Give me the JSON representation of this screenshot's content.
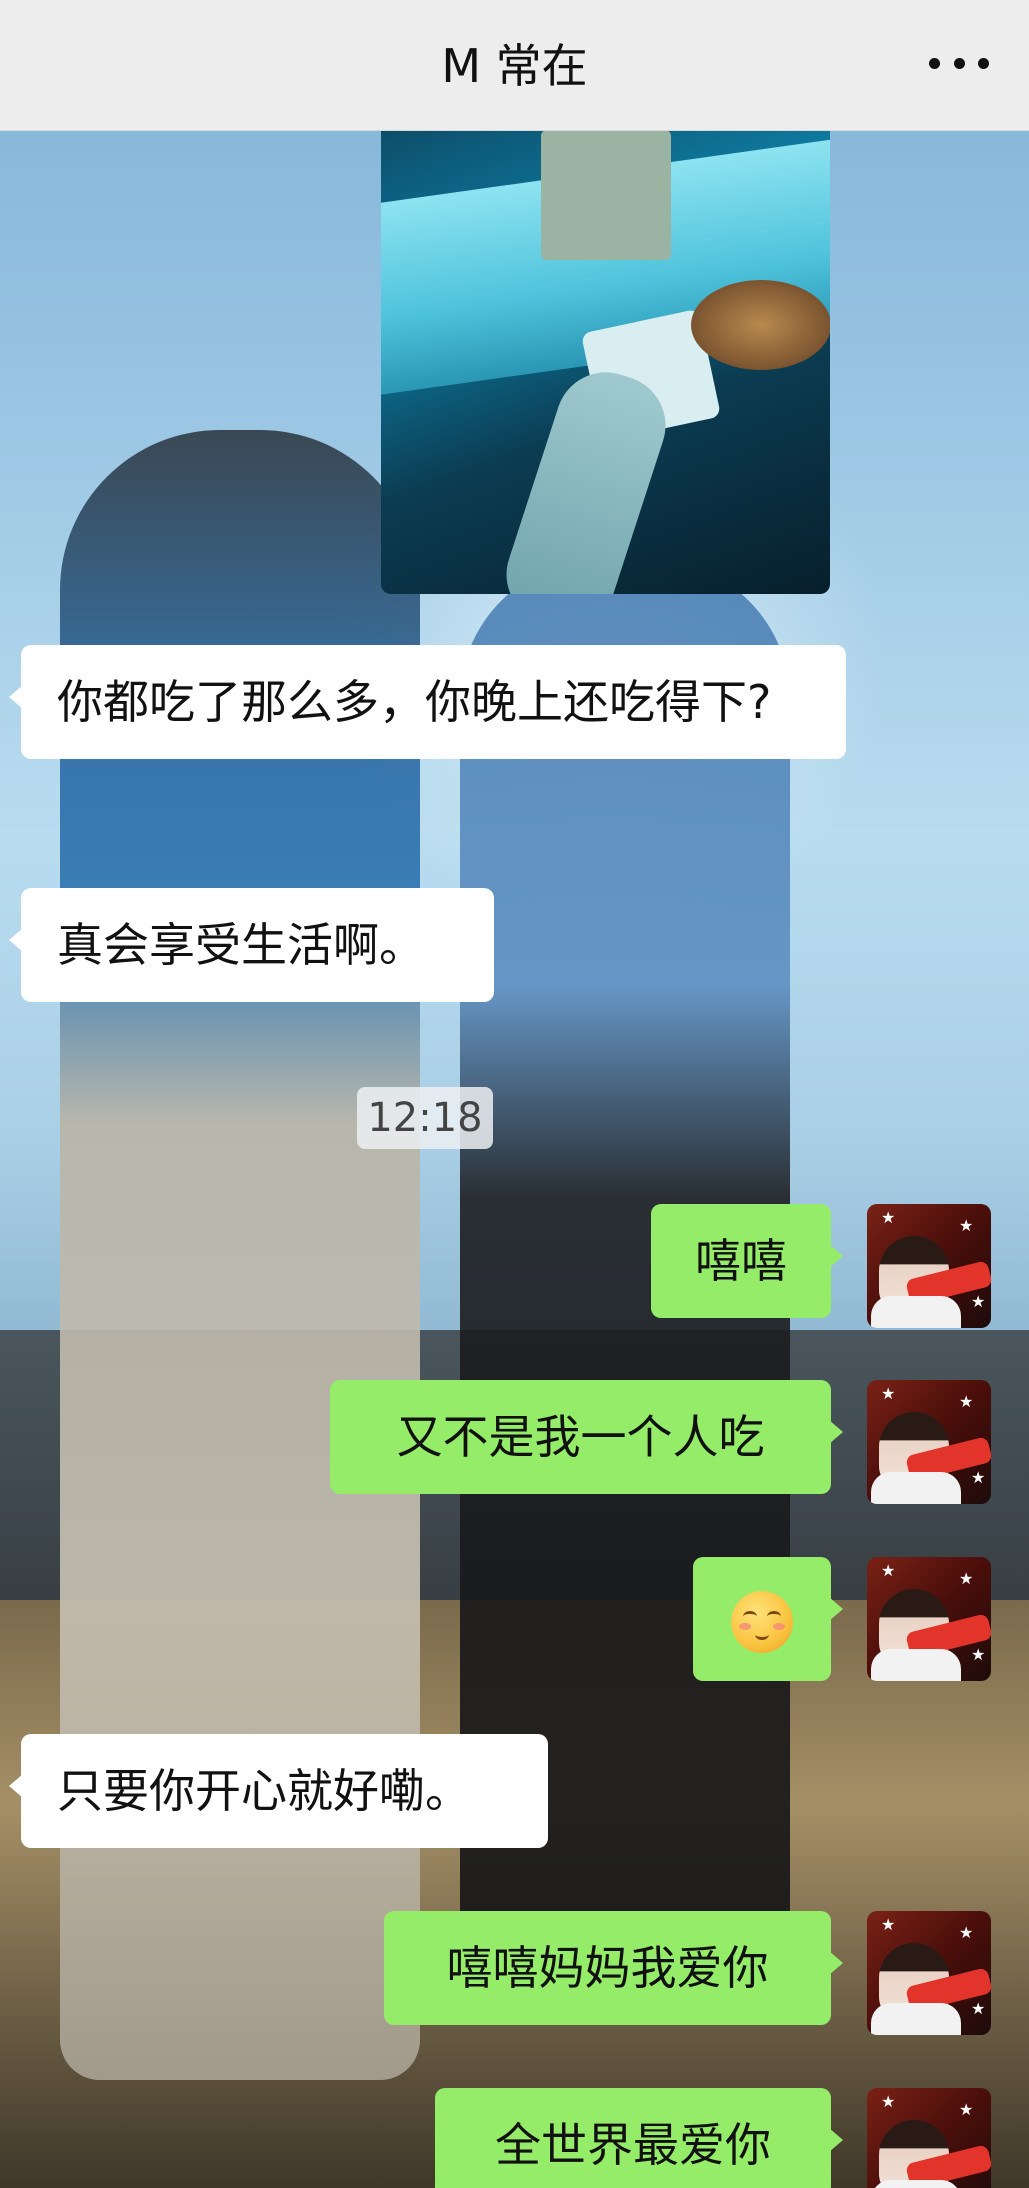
{
  "header": {
    "title": "M 常在",
    "more_icon": "more-dots-icon"
  },
  "messages": [
    {
      "side": "in",
      "type": "image",
      "alt_icon": "photo-image"
    },
    {
      "side": "in",
      "type": "text",
      "text": "你都吃了那么多，你晚上还吃得下?"
    },
    {
      "side": "in",
      "type": "text",
      "text": "真会享受生活啊。"
    },
    {
      "side": "system",
      "type": "time",
      "text": "12:18"
    },
    {
      "side": "out",
      "type": "text",
      "text": "嘻嘻"
    },
    {
      "side": "out",
      "type": "text",
      "text": "又不是我一个人吃"
    },
    {
      "side": "out",
      "type": "emoji",
      "emoji": "shy-smile-emoji"
    },
    {
      "side": "in",
      "type": "text",
      "text": "只要你开心就好嘞。"
    },
    {
      "side": "out",
      "type": "text",
      "text": "嘻嘻妈妈我爱你"
    },
    {
      "side": "out",
      "type": "text",
      "text": "全世界最爱你"
    }
  ],
  "colors": {
    "header_bg": "#ededed",
    "incoming_bubble": "#ffffff",
    "outgoing_bubble": "#95ec69",
    "timestamp_bg": "#ecf0f2"
  }
}
